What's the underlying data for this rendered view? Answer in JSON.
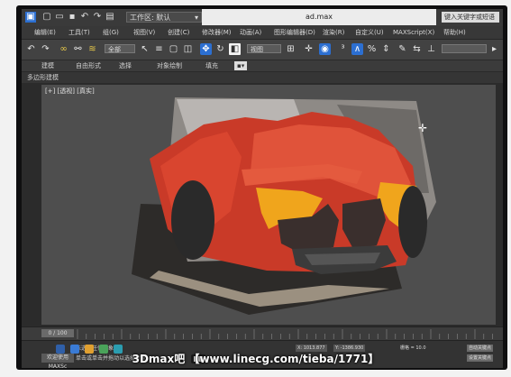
{
  "window": {
    "workspace_label": "工作区: 默认",
    "file_title": "ad.max",
    "search_placeholder": "键入关键字或短语"
  },
  "menus": [
    "编辑(E)",
    "工具(T)",
    "组(G)",
    "视图(V)",
    "创建(C)",
    "修改器(M)",
    "动画(A)",
    "图形编辑器(D)",
    "渲染(R)",
    "自定义(U)",
    "MAXScript(X)",
    "帮助(H)"
  ],
  "toolbar": {
    "selection_filter": "全部",
    "reference_coord": "视图"
  },
  "ribbon": {
    "tabs": [
      "建模",
      "自由形式",
      "选择",
      "对象绘制",
      "填充"
    ],
    "panel_label": "多边形建模"
  },
  "viewport": {
    "label": "[+] [透视] [真实]"
  },
  "timeline": {
    "frame_indicator": "0 / 100"
  },
  "status": {
    "line1": "未选定任何对象",
    "line2": "单击或单击并拖动以选择对象",
    "maxscript_label": "欢迎使用 MAXSc",
    "coord_x": "X: 1013.877",
    "coord_y": "Y: -1386.930",
    "grid": "栅格 = 10.0",
    "auto_key": "自动关键点",
    "set_key": "设置关键点"
  },
  "watermark": {
    "text": "3Dmax吧 【www.linecg.com/tieba/1771】"
  },
  "colors": {
    "car_red": "#d9452f",
    "light_yellow": "#f0a51c",
    "toolbar_blue": "#2c6fd1"
  }
}
